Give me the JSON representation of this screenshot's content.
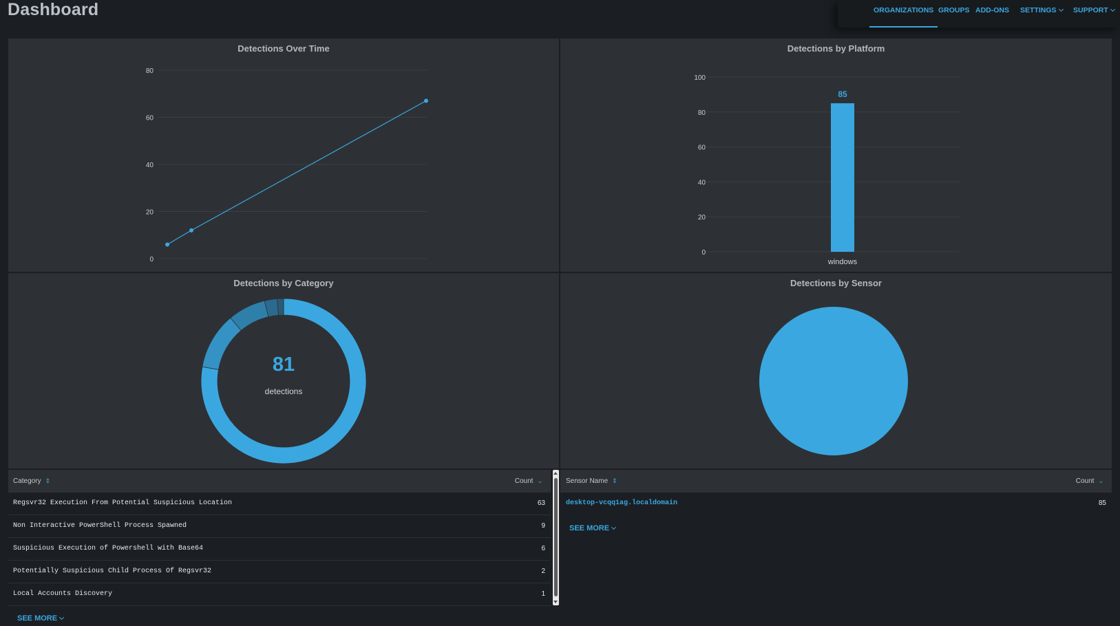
{
  "page": {
    "title": "Dashboard"
  },
  "nav": [
    {
      "label": "ORGANIZATIONS",
      "active": true
    },
    {
      "label": "GROUPS"
    },
    {
      "label": "ADD-ONS"
    },
    {
      "label": "SETTINGS",
      "dropdown": true
    },
    {
      "label": "SUPPORT",
      "dropdown": true
    }
  ],
  "panels": {
    "over_time": {
      "title": "Detections Over Time"
    },
    "platform": {
      "title": "Detections by Platform"
    },
    "category": {
      "title": "Detections by Category",
      "total": "81",
      "total_label": "detections"
    },
    "sensor": {
      "title": "Detections by Sensor"
    }
  },
  "category_table": {
    "col_category": "Category",
    "col_count": "Count",
    "rows": [
      {
        "name": "Regsvr32 Execution From Potential Suspicious Location",
        "count": "63"
      },
      {
        "name": "Non Interactive PowerShell Process Spawned",
        "count": "9"
      },
      {
        "name": "Suspicious Execution of Powershell with Base64",
        "count": "6"
      },
      {
        "name": "Potentially Suspicious Child Process Of Regsvr32",
        "count": "2"
      },
      {
        "name": "Local Accounts Discovery",
        "count": "1"
      }
    ],
    "see_more": "SEE MORE"
  },
  "sensor_table": {
    "col_name": "Sensor Name",
    "col_count": "Count",
    "rows": [
      {
        "name": "desktop-vcqq1ag.localdomain",
        "count": "85"
      }
    ],
    "see_more": "SEE MORE"
  },
  "colors": {
    "accent": "#3ba7e0",
    "panel": "#2d3135",
    "background": "#1b1f23"
  },
  "chart_data": [
    {
      "type": "line",
      "title": "Detections Over Time",
      "x": [
        1,
        2,
        3
      ],
      "y": [
        6,
        12,
        67
      ],
      "yticks": [
        0,
        20,
        40,
        60,
        80
      ],
      "ylim": [
        0,
        80
      ],
      "grid": true
    },
    {
      "type": "bar",
      "title": "Detections by Platform",
      "categories": [
        "windows"
      ],
      "values": [
        85
      ],
      "data_labels": [
        "85"
      ],
      "yticks": [
        0,
        20,
        40,
        60,
        80,
        100
      ],
      "ylim": [
        0,
        100
      ],
      "grid": true
    },
    {
      "type": "pie",
      "title": "Detections by Category",
      "donut": true,
      "categories": [
        "Regsvr32 Execution From Potential Suspicious Location",
        "Non Interactive PowerShell Process Spawned",
        "Suspicious Execution of Powershell with Base64",
        "Potentially Suspicious Child Process Of Regsvr32",
        "Local Accounts Discovery"
      ],
      "values": [
        63,
        9,
        6,
        2,
        1
      ],
      "colors": [
        "#3ba7e0",
        "#3592c4",
        "#2f7fab",
        "#2a6a8f",
        "#2a5a76"
      ]
    },
    {
      "type": "pie",
      "title": "Detections by Sensor",
      "categories": [
        "desktop-vcqq1ag.localdomain"
      ],
      "values": [
        85
      ],
      "colors": [
        "#3ba7e0"
      ]
    }
  ]
}
